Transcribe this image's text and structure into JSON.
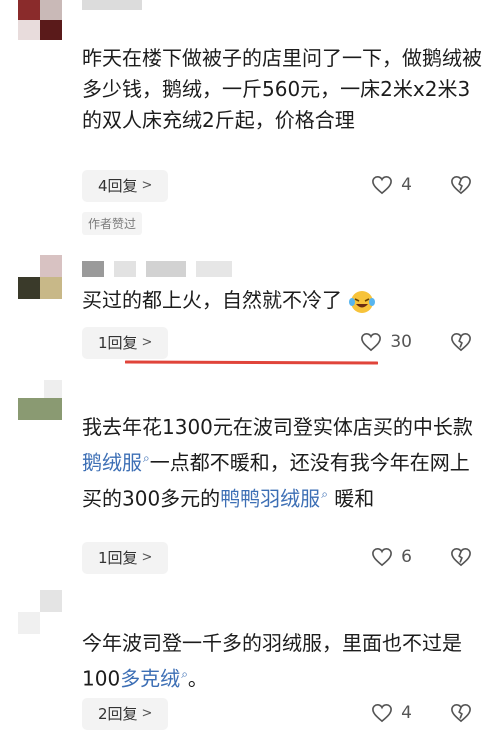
{
  "comments": [
    {
      "text": "昨天在楼下做被子的店里问了一下，做鹅绒被多少钱，鹅绒，一斤560元，一床2米x2米3的双人床充绒2斤起，价格合理",
      "reply_label": "4回复",
      "likes": "4",
      "badge": "作者赞过"
    },
    {
      "text": "买过的都上火，自然就不冷了",
      "emoji": "laughing-tears-emoji",
      "reply_label": "1回复",
      "likes": "30"
    },
    {
      "text_parts": [
        "我去年花1300元在波司登实体店买的中长款",
        "鹅绒服",
        "一点都不暖和，还没有我今年在网上买的300多元的",
        "鸭鸭羽绒服",
        "暖和"
      ],
      "reply_label": "1回复",
      "likes": "6"
    },
    {
      "text_parts": [
        "今年波司登一千多的羽绒服，里面也不过是100",
        "多克绒",
        "。"
      ],
      "reply_label": "2回复",
      "likes": "4"
    }
  ],
  "colors": {
    "link": "#3d6fb5",
    "highlight_line": "#e0443a",
    "reply_bg": "#f3f3f3"
  },
  "icons": [
    "heart-icon",
    "broken-heart-icon",
    "chevron-right-icon",
    "search-icon"
  ]
}
